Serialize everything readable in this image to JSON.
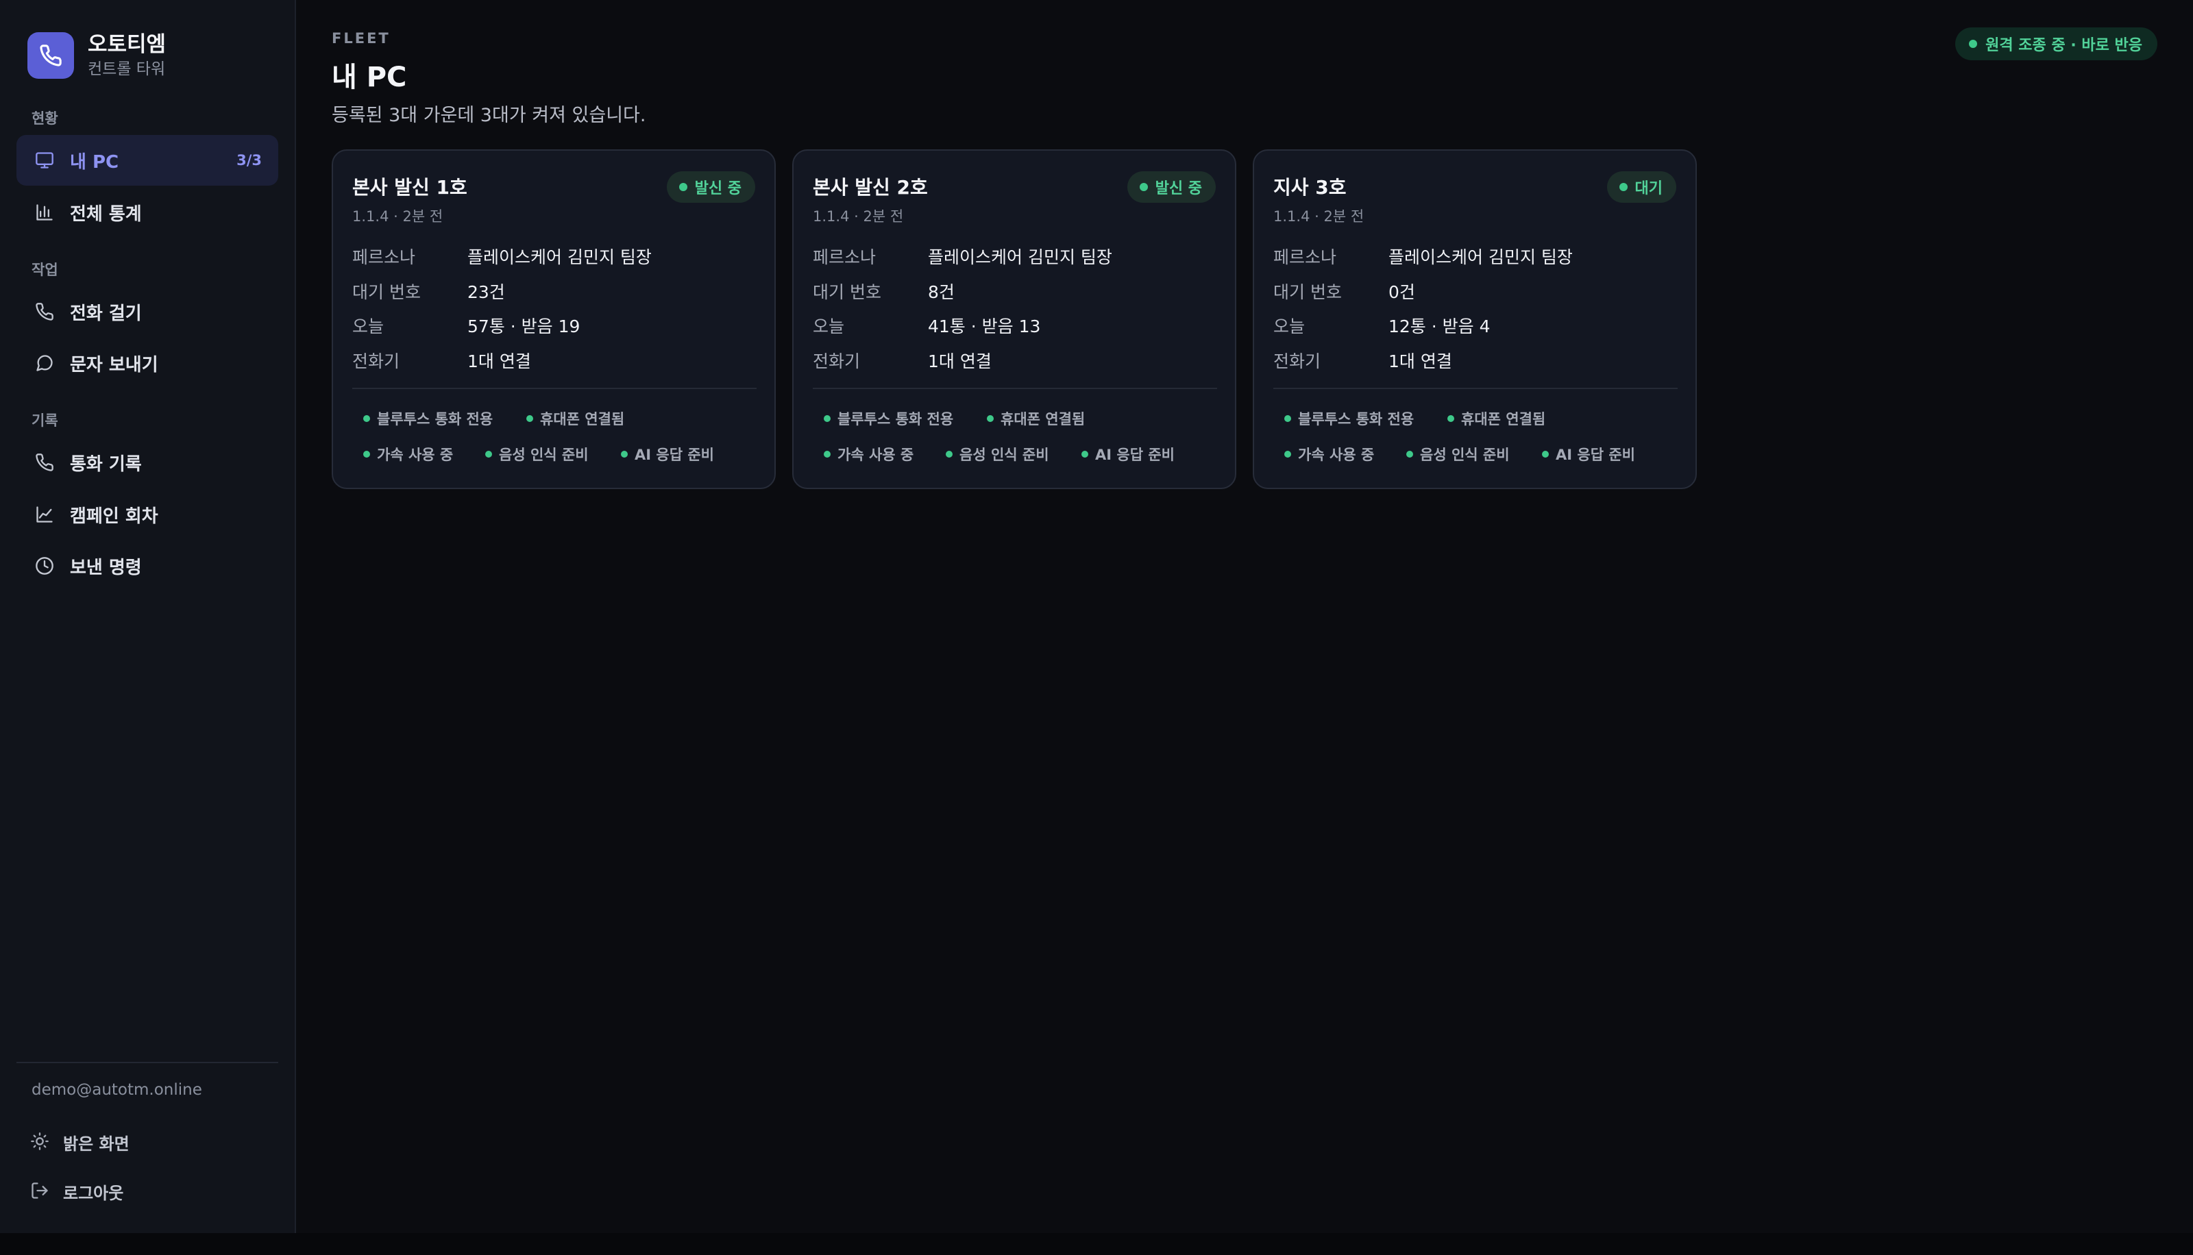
{
  "brand": {
    "name": "오토티엠",
    "subtitle": "컨트롤 타워"
  },
  "sidebar": {
    "sections": [
      "현황",
      "작업",
      "기록"
    ],
    "items": [
      {
        "label": "내 PC",
        "count": "3/3",
        "icon": "monitor-icon",
        "active": true
      },
      {
        "label": "전체 통계",
        "icon": "bar-chart-icon"
      },
      {
        "label": "전화 걸기",
        "icon": "phone-icon"
      },
      {
        "label": "문자 보내기",
        "icon": "chat-bubble-icon"
      },
      {
        "label": "통화 기록",
        "icon": "phone-icon"
      },
      {
        "label": "캠페인 회차",
        "icon": "line-chart-icon"
      },
      {
        "label": "보낸 명령",
        "icon": "clock-icon"
      }
    ],
    "user_email": "demo@autotm.online",
    "theme_toggle": "밝은 화면",
    "logout": "로그아웃"
  },
  "header": {
    "eyebrow": "FLEET",
    "title": "내 PC",
    "description": "등록된 3대 가운데 3대가 켜져 있습니다.",
    "remote_status": "원격 조종 중 · 바로 반응"
  },
  "fields": {
    "persona": "페르소나",
    "queue": "대기 번호",
    "today": "오늘",
    "phone": "전화기"
  },
  "cards": [
    {
      "title": "본사 발신 1호",
      "meta": "1.1.4 · 2분 전",
      "status": "발신 중",
      "persona": "플레이스케어 김민지 팀장",
      "queue": "23건",
      "today": "57통 · 받음 19",
      "phone": "1대 연결",
      "chips": [
        "블루투스 통화 전용",
        "휴대폰 연결됨",
        "가속 사용 중",
        "음성 인식 준비",
        "AI 응답 준비"
      ]
    },
    {
      "title": "본사 발신 2호",
      "meta": "1.1.4 · 2분 전",
      "status": "발신 중",
      "persona": "플레이스케어 김민지 팀장",
      "queue": "8건",
      "today": "41통 · 받음 13",
      "phone": "1대 연결",
      "chips": [
        "블루투스 통화 전용",
        "휴대폰 연결됨",
        "가속 사용 중",
        "음성 인식 준비",
        "AI 응답 준비"
      ]
    },
    {
      "title": "지사 3호",
      "meta": "1.1.4 · 2분 전",
      "status": "대기",
      "persona": "플레이스케어 김민지 팀장",
      "queue": "0건",
      "today": "12통 · 받음 4",
      "phone": "1대 연결",
      "chips": [
        "블루투스 통화 전용",
        "휴대폰 연결됨",
        "가속 사용 중",
        "음성 인식 준비",
        "AI 응답 준비"
      ]
    }
  ],
  "colors": {
    "accent": "#5b5fd6",
    "accent_text": "#8e93f2",
    "success": "#3ec98a",
    "background": "#0b0c10",
    "sidebar": "#11141b",
    "card": "#131722"
  }
}
